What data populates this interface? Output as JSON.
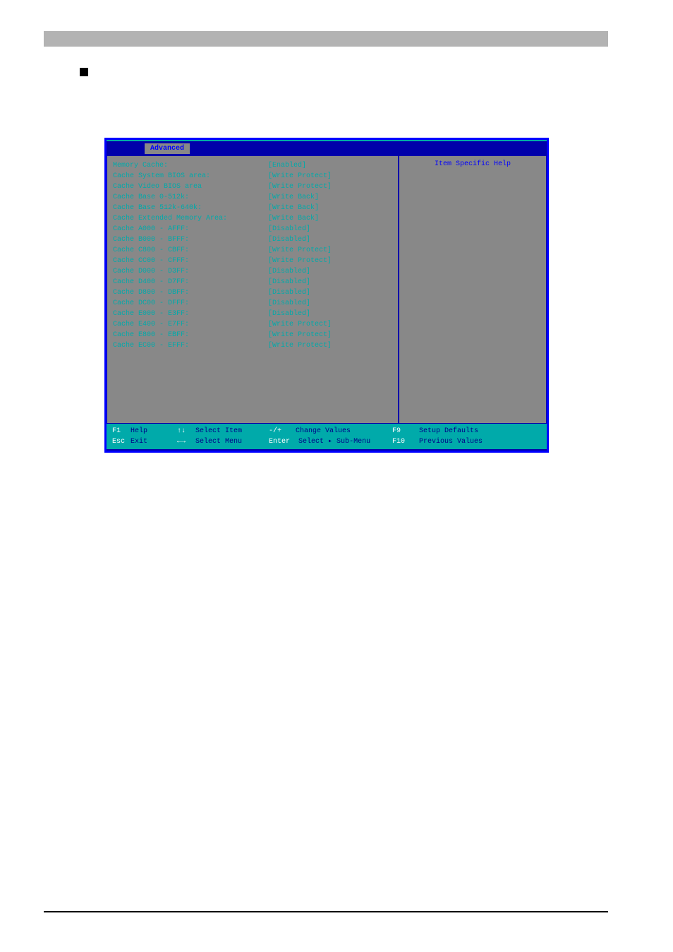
{
  "menubar": {
    "active_tab": "Advanced"
  },
  "help_panel": {
    "title": "Item Specific Help"
  },
  "settings": [
    {
      "label": "Memory Cache:",
      "value": "[Enabled]"
    },
    {
      "label": "Cache System BIOS area:",
      "value": "[Write Protect]"
    },
    {
      "label": "Cache Video BIOS area",
      "value": "[Write Protect]"
    },
    {
      "label": "Cache Base 0-512k:",
      "value": "[Write Back]"
    },
    {
      "label": "Cache Base 512k-640k:",
      "value": "[Write Back]"
    },
    {
      "label": "Cache Extended Memory Area:",
      "value": "[Write Back]"
    },
    {
      "label": "Cache A000 - AFFF:",
      "value": "[Disabled]"
    },
    {
      "label": "Cache B000 - BFFF:",
      "value": "[Disabled]"
    },
    {
      "label": "Cache C800 - CBFF:",
      "value": "[Write Protect]"
    },
    {
      "label": "Cache CC00 - CFFF:",
      "value": "[Write Protect]"
    },
    {
      "label": "Cache D000 - D3FF:",
      "value": "[Disabled]"
    },
    {
      "label": "Cache D400 - D7FF:",
      "value": "[Disabled]"
    },
    {
      "label": "Cache D800 - DBFF:",
      "value": "[Disabled]"
    },
    {
      "label": "Cache DC00 - DFFF:",
      "value": "[Disabled]"
    },
    {
      "label": "Cache E000 - E3FF:",
      "value": "[Disabled]"
    },
    {
      "label": "Cache E400 - E7FF:",
      "value": "[Write Protect]"
    },
    {
      "label": "Cache E800 - EBFF:",
      "value": "[Write Protect]"
    },
    {
      "label": "Cache EC00 - EFFF:",
      "value": "[Write Protect]"
    }
  ],
  "footer": {
    "r1": {
      "k1": "F1",
      "t1": "Help",
      "k2": "↑↓",
      "t2": "Select Item",
      "k3": "-/+",
      "t3": "Change Values",
      "k4": "F9",
      "t4": "Setup Defaults"
    },
    "r2": {
      "k1": "Esc",
      "t1": "Exit",
      "k2": "←→",
      "t2": "Select Menu",
      "k3": "Enter",
      "t3": "Select ▸ Sub-Menu",
      "k4": "F10",
      "t4": "Previous Values"
    }
  }
}
